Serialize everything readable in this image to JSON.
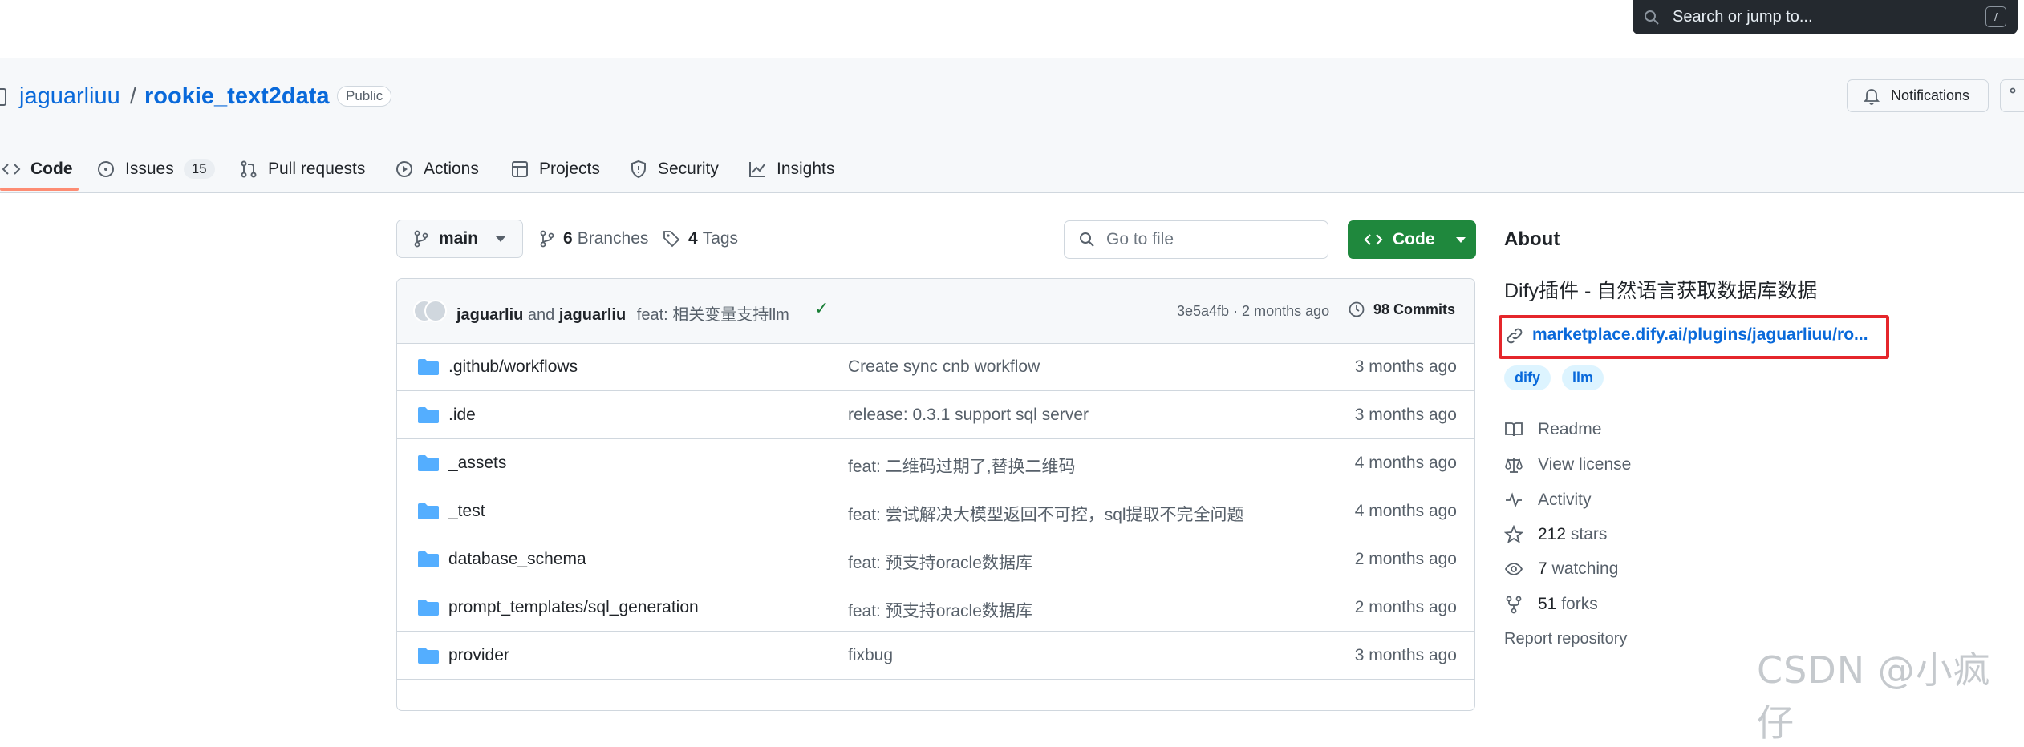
{
  "search": {
    "placeholder": "Search or jump to...",
    "shortcut": "/"
  },
  "repo": {
    "owner": "jaguarliuu",
    "separator": "/",
    "name": "rookie_text2data",
    "visibility": "Public"
  },
  "header_actions": {
    "notifications": "Notifications"
  },
  "tabs": [
    {
      "label": "Code",
      "icon": "code-icon"
    },
    {
      "label": "Issues",
      "icon": "issue-icon",
      "count": "15"
    },
    {
      "label": "Pull requests",
      "icon": "pull-request-icon"
    },
    {
      "label": "Actions",
      "icon": "play-icon"
    },
    {
      "label": "Projects",
      "icon": "table-icon"
    },
    {
      "label": "Security",
      "icon": "shield-icon"
    },
    {
      "label": "Insights",
      "icon": "graph-icon"
    }
  ],
  "filebar": {
    "branch": "main",
    "branches_count": "6",
    "branches_label": "Branches",
    "tags_count": "4",
    "tags_label": "Tags",
    "go_to_file": "Go to file",
    "code_button": "Code"
  },
  "commit": {
    "author1": "jaguarliu",
    "and": "and",
    "author2": "jaguarliu",
    "message": "feat: 相关变量支持llm",
    "hash_time": "3e5a4fb · 2 months ago",
    "commits": "98 Commits"
  },
  "files": [
    {
      "name": ".github/workflows",
      "message": "Create sync cnb workflow",
      "date": "3 months ago"
    },
    {
      "name": ".ide",
      "message": "release: 0.3.1 support sql server",
      "date": "3 months ago"
    },
    {
      "name": "_assets",
      "message": "feat: 二维码过期了,替换二维码",
      "date": "4 months ago"
    },
    {
      "name": "_test",
      "message": "feat: 尝试解决大模型返回不可控，sql提取不完全问题",
      "date": "4 months ago"
    },
    {
      "name": "database_schema",
      "message": "feat: 预支持oracle数据库",
      "date": "2 months ago"
    },
    {
      "name": "prompt_templates/sql_generation",
      "message": "feat: 预支持oracle数据库",
      "date": "2 months ago"
    },
    {
      "name": "provider",
      "message": "fixbug",
      "date": "3 months ago"
    }
  ],
  "about": {
    "title": "About",
    "description": "Dify插件 - 自然语言获取数据库数据",
    "homepage": "marketplace.dify.ai/plugins/jaguarliuu/ro...",
    "topics": [
      "dify",
      "llm"
    ],
    "readme": "Readme",
    "license": "View license",
    "activity": "Activity",
    "stars": "212",
    "stars_label": "stars",
    "watching": "7",
    "watching_label": "watching",
    "forks": "51",
    "forks_label": "forks",
    "report": "Report repository"
  },
  "watermark": "CSDN @小疯仔",
  "colors": {
    "accent": "#0969da",
    "green": "#1f883d",
    "highlight_box": "#e5262b",
    "tab_underline": "#fd8c73"
  }
}
